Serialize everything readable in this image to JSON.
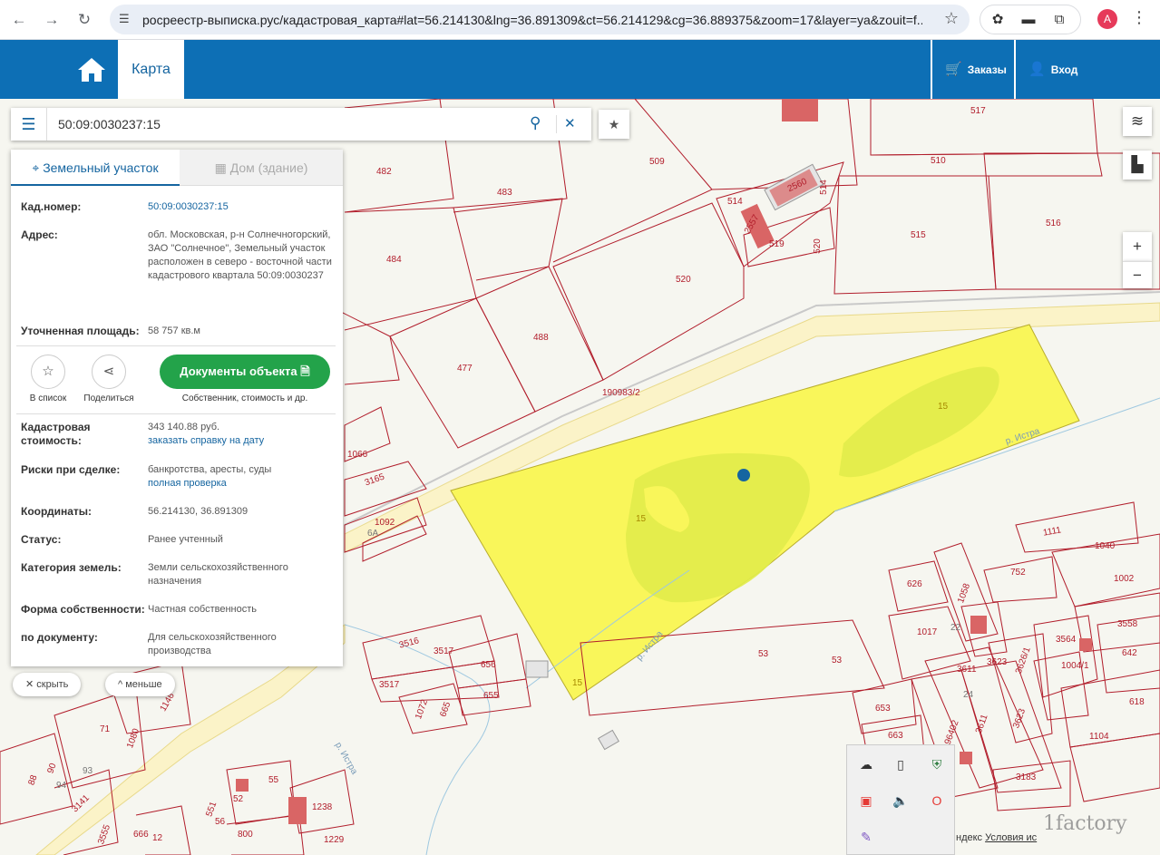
{
  "browser": {
    "url": "росреестр-выписка.рус/кадастровая_карта#lat=56.214130&lng=36.891309&ct=56.214129&cg=36.889375&zoom=17&layer=ya&zouit=f...",
    "profile_initial": "A"
  },
  "header": {
    "tab_label": "Карта",
    "orders_label": "Заказы",
    "login_label": "Вход"
  },
  "search": {
    "query": "50:09:0030237:15"
  },
  "panel": {
    "tab_land": "Земельный участок",
    "tab_house": "Дом (здание)",
    "fields": {
      "cad_number_key": "Кад.номер:",
      "cad_number_val": "50:09:0030237:15",
      "address_key": "Адрес:",
      "address_val": "обл. Московская, р-н Солнечногорский, ЗАО \"Солнечное\", Земельный участок расположен в северо - восточной части кадастрового квартала 50:09:0030237",
      "area_key": "Уточненная площадь:",
      "area_val": "58 757 кв.м",
      "cost_key": "Кадастровая стоимость:",
      "cost_val": "343 140.88 руб.",
      "cost_link": "заказать справку на дату",
      "risk_key": "Риски при сделке:",
      "risk_val": "банкротства, аресты, суды",
      "risk_link": "полная проверка",
      "coords_key": "Координаты:",
      "coords_val": "56.214130, 36.891309",
      "status_key": "Статус:",
      "status_val": "Ранее учтенный",
      "category_key": "Категория земель:",
      "category_val": "Земли сельскохозяйственного назначения",
      "ownership_key": "Форма собственности:",
      "ownership_val": "Частная собственность",
      "bydoc_key": "по документу:",
      "bydoc_val": "Для сельскохозяйственного производства"
    },
    "actions": {
      "to_list": "В список",
      "share": "Поделиться",
      "docs": "Документы объекта",
      "docs_sub": "Собственник, стоимость и др."
    }
  },
  "pills": {
    "hide": "скрыть",
    "less": "меньше"
  },
  "map": {
    "labels": [
      "482",
      "483",
      "509",
      "517",
      "510",
      "514",
      "2557",
      "2560",
      "519",
      "514",
      "520",
      "515",
      "516",
      "484",
      "520",
      "488",
      "477",
      "190983/2",
      "15",
      "15",
      "15",
      "р. Истра",
      "1066",
      "3165",
      "1092",
      "6А",
      "626",
      "1058",
      "752",
      "1111",
      "1040",
      "1002",
      "1017",
      "3558",
      "3564",
      "642",
      "3516",
      "3517",
      "656",
      "655",
      "3517",
      "1072",
      "665",
      "53",
      "53",
      "3611",
      "3623",
      "3626/1",
      "1004/1",
      "618",
      "653",
      "663",
      "196402",
      "3611",
      "3623",
      "1104",
      "3183",
      "р. Истра",
      "71",
      "1080",
      "1146",
      "90",
      "88",
      "93",
      "94",
      "3141",
      "55",
      "52",
      "1238",
      "551",
      "56",
      "800",
      "1229",
      "3555",
      "666",
      "12",
      "24",
      "22",
      "р. Истра"
    ],
    "road_label": "р. Истра"
  },
  "footer": {
    "text": "ндекс",
    "terms": "Условия ис"
  },
  "watermark": "1factory"
}
